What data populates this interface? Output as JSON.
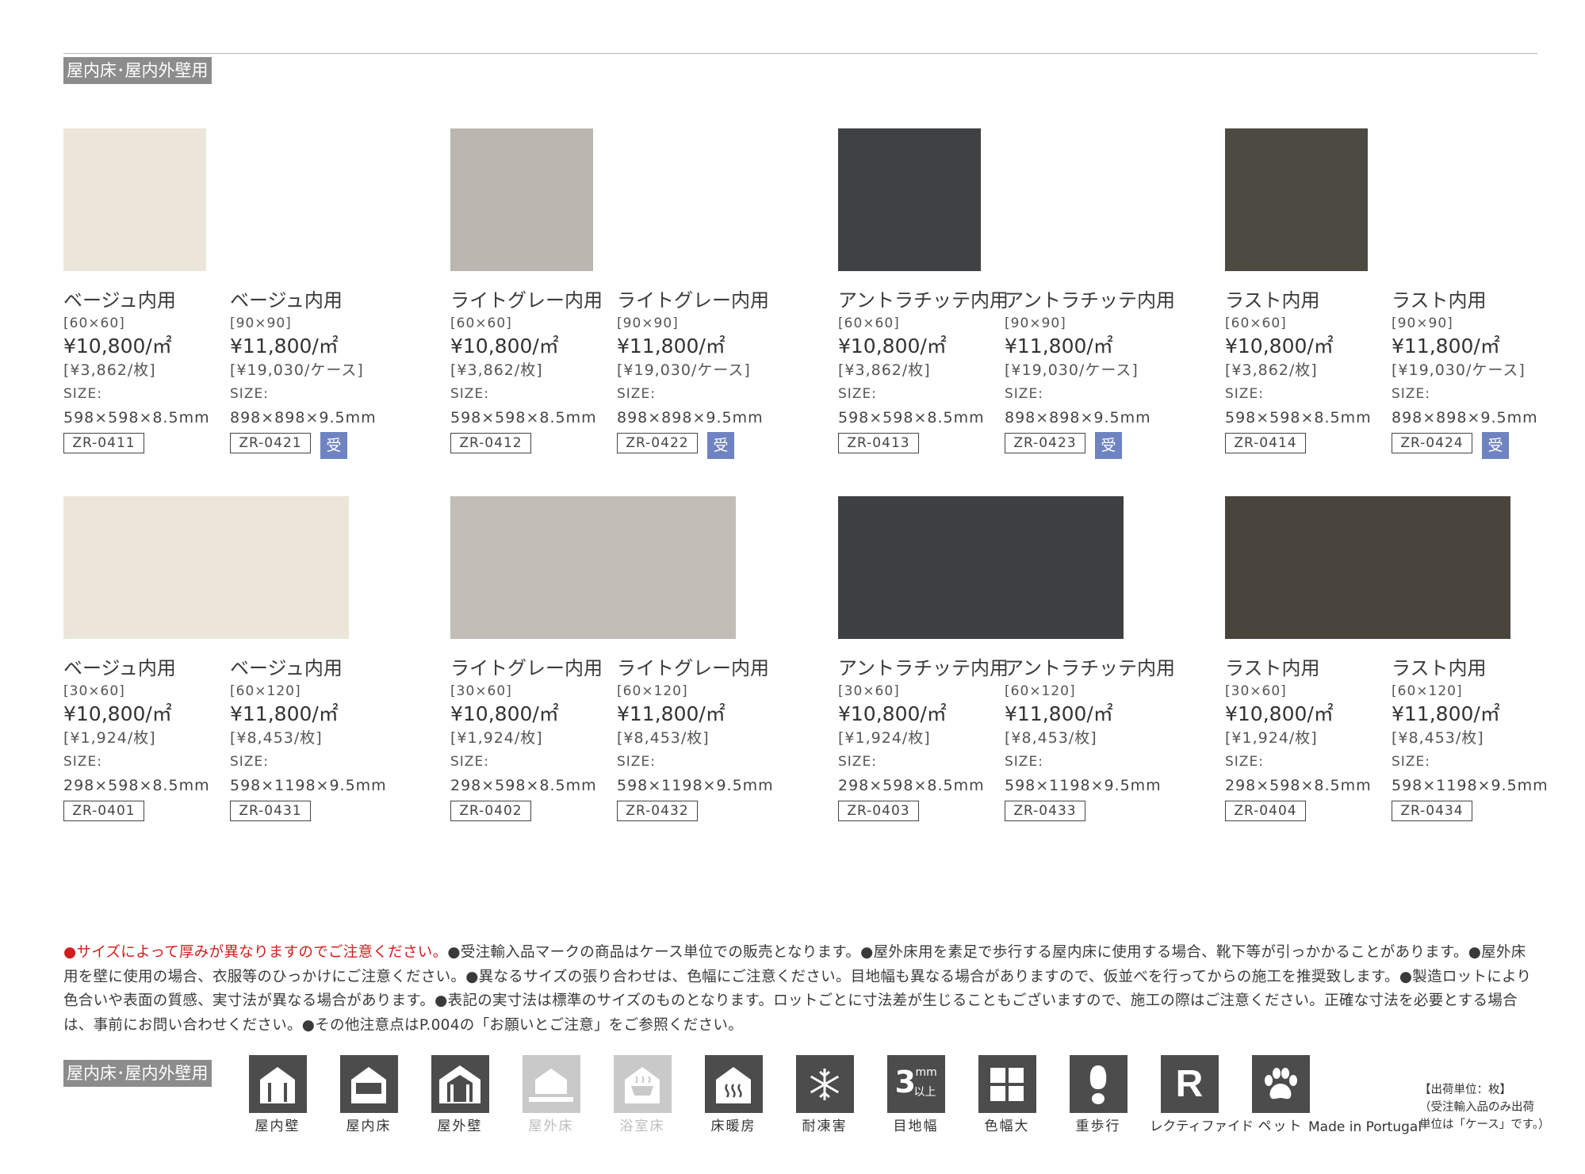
{
  "section_label": "屋内床･屋内外壁用",
  "colors": {
    "badge": "#6f83c1",
    "warning": "#d21d1d",
    "icon_bg": "#4c4c4c",
    "icon_disabled": "#c9c9c9"
  },
  "rows": [
    {
      "groups": [
        {
          "swatch_color": "#ebe6d9",
          "products": [
            {
              "name": "ベージュ内用",
              "size": "[60×60]",
              "price": "¥10,800/㎡",
              "unit_price": "[¥3,862/枚]",
              "size_caption": "SIZE:",
              "dims": "598×598×8.5mm",
              "code": "ZR-0411",
              "badge": ""
            },
            {
              "name": "ベージュ内用",
              "size": "[90×90]",
              "price": "¥11,800/㎡",
              "unit_price": "[¥19,030/ケース]",
              "size_caption": "SIZE:",
              "dims": "898×898×9.5mm",
              "code": "ZR-0421",
              "badge": "受"
            }
          ]
        },
        {
          "swatch_color": "#bcb6b1",
          "products": [
            {
              "name": "ライトグレー内用",
              "size": "[60×60]",
              "price": "¥10,800/㎡",
              "unit_price": "[¥3,862/枚]",
              "size_caption": "SIZE:",
              "dims": "598×598×8.5mm",
              "code": "ZR-0412",
              "badge": ""
            },
            {
              "name": "ライトグレー内用",
              "size": "[90×90]",
              "price": "¥11,800/㎡",
              "unit_price": "[¥19,030/ケース]",
              "size_caption": "SIZE:",
              "dims": "898×898×9.5mm",
              "code": "ZR-0422",
              "badge": "受"
            }
          ]
        },
        {
          "swatch_color": "#3f4142",
          "products": [
            {
              "name": "アントラチッテ内用",
              "size": "[60×60]",
              "price": "¥10,800/㎡",
              "unit_price": "[¥3,862/枚]",
              "size_caption": "SIZE:",
              "dims": "598×598×8.5mm",
              "code": "ZR-0413",
              "badge": ""
            },
            {
              "name": "アントラチッテ内用",
              "size": "[90×90]",
              "price": "¥11,800/㎡",
              "unit_price": "[¥19,030/ケース]",
              "size_caption": "SIZE:",
              "dims": "898×898×9.5mm",
              "code": "ZR-0423",
              "badge": "受"
            }
          ]
        },
        {
          "swatch_color": "#4d4a42",
          "products": [
            {
              "name": "ラスト内用",
              "size": "[60×60]",
              "price": "¥10,800/㎡",
              "unit_price": "[¥3,862/枚]",
              "size_caption": "SIZE:",
              "dims": "598×598×8.5mm",
              "code": "ZR-0414",
              "badge": ""
            },
            {
              "name": "ラスト内用",
              "size": "[90×90]",
              "price": "¥11,800/㎡",
              "unit_price": "[¥19,030/ケース]",
              "size_caption": "SIZE:",
              "dims": "898×898×9.5mm",
              "code": "ZR-0424",
              "badge": "受"
            }
          ]
        }
      ]
    },
    {
      "groups": [
        {
          "swatch_color": "#ebe6d9",
          "products": [
            {
              "name": "ベージュ内用",
              "size": "[30×60]",
              "price": "¥10,800/㎡",
              "unit_price": "[¥1,924/枚]",
              "size_caption": "SIZE:",
              "dims": "298×598×8.5mm",
              "code": "ZR-0401",
              "badge": ""
            },
            {
              "name": "ベージュ内用",
              "size": "[60×120]",
              "price": "¥11,800/㎡",
              "unit_price": "[¥8,453/枚]",
              "size_caption": "SIZE:",
              "dims": "598×1198×9.5mm",
              "code": "ZR-0431",
              "badge": ""
            }
          ]
        },
        {
          "swatch_color": "#c3bdb8",
          "products": [
            {
              "name": "ライトグレー内用",
              "size": "[30×60]",
              "price": "¥10,800/㎡",
              "unit_price": "[¥1,924/枚]",
              "size_caption": "SIZE:",
              "dims": "298×598×8.5mm",
              "code": "ZR-0402",
              "badge": ""
            },
            {
              "name": "ライトグレー内用",
              "size": "[60×120]",
              "price": "¥11,800/㎡",
              "unit_price": "[¥8,453/枚]",
              "size_caption": "SIZE:",
              "dims": "598×1198×9.5mm",
              "code": "ZR-0432",
              "badge": ""
            }
          ]
        },
        {
          "swatch_color": "#3e4041",
          "products": [
            {
              "name": "アントラチッテ内用",
              "size": "[30×60]",
              "price": "¥10,800/㎡",
              "unit_price": "[¥1,924/枚]",
              "size_caption": "SIZE:",
              "dims": "298×598×8.5mm",
              "code": "ZR-0403",
              "badge": ""
            },
            {
              "name": "アントラチッテ内用",
              "size": "[60×120]",
              "price": "¥11,800/㎡",
              "unit_price": "[¥8,453/枚]",
              "size_caption": "SIZE:",
              "dims": "598×1198×9.5mm",
              "code": "ZR-0433",
              "badge": ""
            }
          ]
        },
        {
          "swatch_color": "#4a453c",
          "products": [
            {
              "name": "ラスト内用",
              "size": "[30×60]",
              "price": "¥10,800/㎡",
              "unit_price": "[¥1,924/枚]",
              "size_caption": "SIZE:",
              "dims": "298×598×8.5mm",
              "code": "ZR-0404",
              "badge": ""
            },
            {
              "name": "ラスト内用",
              "size": "[60×120]",
              "price": "¥11,800/㎡",
              "unit_price": "[¥8,453/枚]",
              "size_caption": "SIZE:",
              "dims": "598×1198×9.5mm",
              "code": "ZR-0434",
              "badge": ""
            }
          ]
        }
      ]
    }
  ],
  "notes": {
    "warning": "●サイズによって厚みが異なりますのでご注意ください。",
    "body": "●受注輸入品マークの商品はケース単位での販売となります。●屋外床用を素足で歩行する屋内床に使用する場合、靴下等が引っかかることがあります。●屋外床用を壁に使用の場合、衣服等のひっかけにご注意ください。●異なるサイズの張り合わせは、色幅にご注意ください。目地幅も異なる場合がありますので、仮並べを行ってからの施工を推奨致します。●製造ロットにより色合いや表面の質感、実寸法が異なる場合があります。●表記の実寸法は標準のサイズのものとなります。ロットごとに寸法差が生じることもございますので、施工の際はご注意ください。正確な寸法を必要とする場合は、事前にお問い合わせください。●その他注意点はP.004の「お願いとご注意」をご参照ください。"
  },
  "legend_label": "屋内床･屋内外壁用",
  "legend": [
    {
      "icon": "indoor-wall-icon",
      "label": "屋内壁",
      "active": true
    },
    {
      "icon": "indoor-floor-icon",
      "label": "屋内床",
      "active": true
    },
    {
      "icon": "outdoor-wall-icon",
      "label": "屋外壁",
      "active": true
    },
    {
      "icon": "outdoor-floor-icon",
      "label": "屋外床",
      "active": false
    },
    {
      "icon": "bathroom-floor-icon",
      "label": "浴室床",
      "active": false
    },
    {
      "icon": "floor-heating-icon",
      "label": "床暖房",
      "active": true
    },
    {
      "icon": "frost-resistant-icon",
      "label": "耐凍害",
      "active": true
    },
    {
      "icon": "joint-width-icon",
      "label": "目地幅",
      "active": true,
      "icon_text": "3",
      "icon_sup": "mm",
      "icon_sub": "以上"
    },
    {
      "icon": "color-variation-icon",
      "label": "色幅大",
      "active": true
    },
    {
      "icon": "heavy-traffic-icon",
      "label": "重歩行",
      "active": true
    },
    {
      "icon": "rectified-icon",
      "label": "レクティファイド",
      "active": true,
      "icon_text": "R"
    },
    {
      "icon": "pet-icon",
      "label": "ペット",
      "active": true
    }
  ],
  "made_in": "Made in Portugal",
  "shipping_note": [
    "【出荷単位：枚】",
    "（受注輸入品のみ出荷",
    "単位は「ケース」です。）"
  ]
}
